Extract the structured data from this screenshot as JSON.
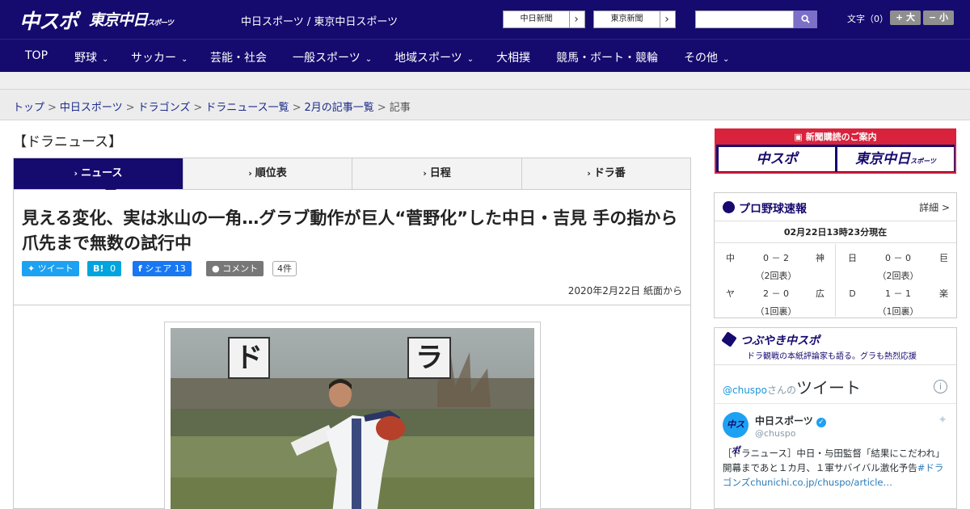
{
  "header": {
    "logo_chuspo": "中スポ",
    "logo_tokyo": "東京中日",
    "logo_tokyo_small": "スポーツ",
    "site_title": "中日スポーツ / 東京中日スポーツ",
    "links": [
      {
        "label": "中日新聞",
        "chevron": "›"
      },
      {
        "label": "東京新聞",
        "chevron": "›"
      }
    ],
    "search_icon": "search-icon",
    "fontsize_label": "文字（0）",
    "font_larger": "+ 大",
    "font_smaller": "− 小"
  },
  "nav": {
    "items": [
      {
        "label": "TOP",
        "caret": ""
      },
      {
        "label": "野球",
        "caret": "⌄"
      },
      {
        "label": "サッカー",
        "caret": "⌄"
      },
      {
        "label": "芸能・社会",
        "caret": ""
      },
      {
        "label": "一般スポーツ",
        "caret": "⌄"
      },
      {
        "label": "地域スポーツ",
        "caret": "⌄"
      },
      {
        "label": "大相撲",
        "caret": ""
      },
      {
        "label": "競馬・ボート・競輪",
        "caret": ""
      },
      {
        "label": "その他",
        "caret": "⌄"
      }
    ]
  },
  "breadcrumb": {
    "items": [
      "トップ",
      "中日スポーツ",
      "ドラゴンズ",
      "ドラニュース一覧",
      "2月の記事一覧"
    ],
    "current": "記事",
    "separator": ">"
  },
  "section": {
    "title": "【ドラニュース】",
    "tabs": [
      {
        "label": "ニュース",
        "active": true
      },
      {
        "label": "順位表",
        "active": false
      },
      {
        "label": "日程",
        "active": false
      },
      {
        "label": "ドラ番",
        "active": false
      }
    ],
    "tab_chevron": "›"
  },
  "article": {
    "headline": "見える変化、実は氷山の一角…グラブ動作が巨人“菅野化”した中日・吉見 手の指から爪先まで無数の試行中",
    "share": {
      "tweet_label": "ツイート",
      "hatena_label": "B!",
      "hatena_count": "0",
      "fb_label": "シェア",
      "fb_count": "13",
      "comment_label": "コメント",
      "comment_count": "4件"
    },
    "date": "2020年2月22日 紙面から",
    "photo_sign_left": "ド",
    "photo_sign_right": "ラ"
  },
  "sidebar": {
    "ad": {
      "heading": "新聞購読のご案内",
      "btn_left": "中スポ",
      "btn_right": "東京中日",
      "btn_right_small": "スポーツ"
    },
    "scores": {
      "title": "プロ野球速報",
      "detail": "詳細 >",
      "timestamp": "02月22日13時23分現在",
      "games": [
        {
          "home": "中",
          "score": "0 － 2",
          "away": "神",
          "inning": "（2回表）"
        },
        {
          "home": "日",
          "score": "0 － 0",
          "away": "巨",
          "inning": "（2回表）"
        },
        {
          "home": "ヤ",
          "score": "2 － 0",
          "away": "広",
          "inning": "（1回裏）"
        },
        {
          "home": "Ｄ",
          "score": "1 － 1",
          "away": "楽",
          "inning": "（1回裏）"
        }
      ]
    },
    "twitter": {
      "title": "つぶやき中スポ",
      "subtitle": "ドラ観戦の本紙評論家も語る。グラも熱烈応援",
      "timeline_handle": "@chuspo",
      "timeline_suffix": "さんの",
      "timeline_title": "ツイート",
      "info_icon": "i",
      "author": "中日スポーツ",
      "author_handle": "@chuspo",
      "tweet_text_1": "［ドラニュース］中日・与田監督「結果にこだわれ」 開幕まであと１カ月、１軍サバイバル激化予",
      "tweet_text_2": "告",
      "tweet_tag": "#ドラゴンズ",
      "tweet_link": "chunichi.co.jp/chuspo/article…"
    }
  },
  "colors": {
    "navy": "#150a6e",
    "twitter_blue": "#1da1f2",
    "hatena_blue": "#00a4de",
    "facebook_blue": "#1877f2",
    "ad_red": "#d9223b"
  }
}
